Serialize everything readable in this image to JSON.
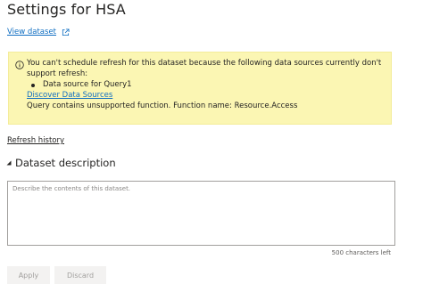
{
  "header": {
    "title": "Settings for HSA"
  },
  "links": {
    "view_dataset": "View dataset",
    "refresh_history": "Refresh history"
  },
  "warning": {
    "message": "You can't schedule refresh for this dataset because the following data sources currently don't support refresh:",
    "data_source": "Data source for Query1",
    "discover_link": "Discover Data Sources",
    "detail": "Query contains unsupported function. Function name: Resource.Access"
  },
  "description_section": {
    "heading": "Dataset description",
    "placeholder": "Describe the contents of this dataset.",
    "value": "",
    "chars_left": "500 characters left"
  },
  "buttons": {
    "apply": "Apply",
    "discard": "Discard"
  },
  "colors": {
    "link": "#0f6ec2",
    "warning_bg": "#fbf6b3",
    "disabled_button_bg": "#f3f2f1",
    "disabled_button_text": "#a19f9d"
  }
}
